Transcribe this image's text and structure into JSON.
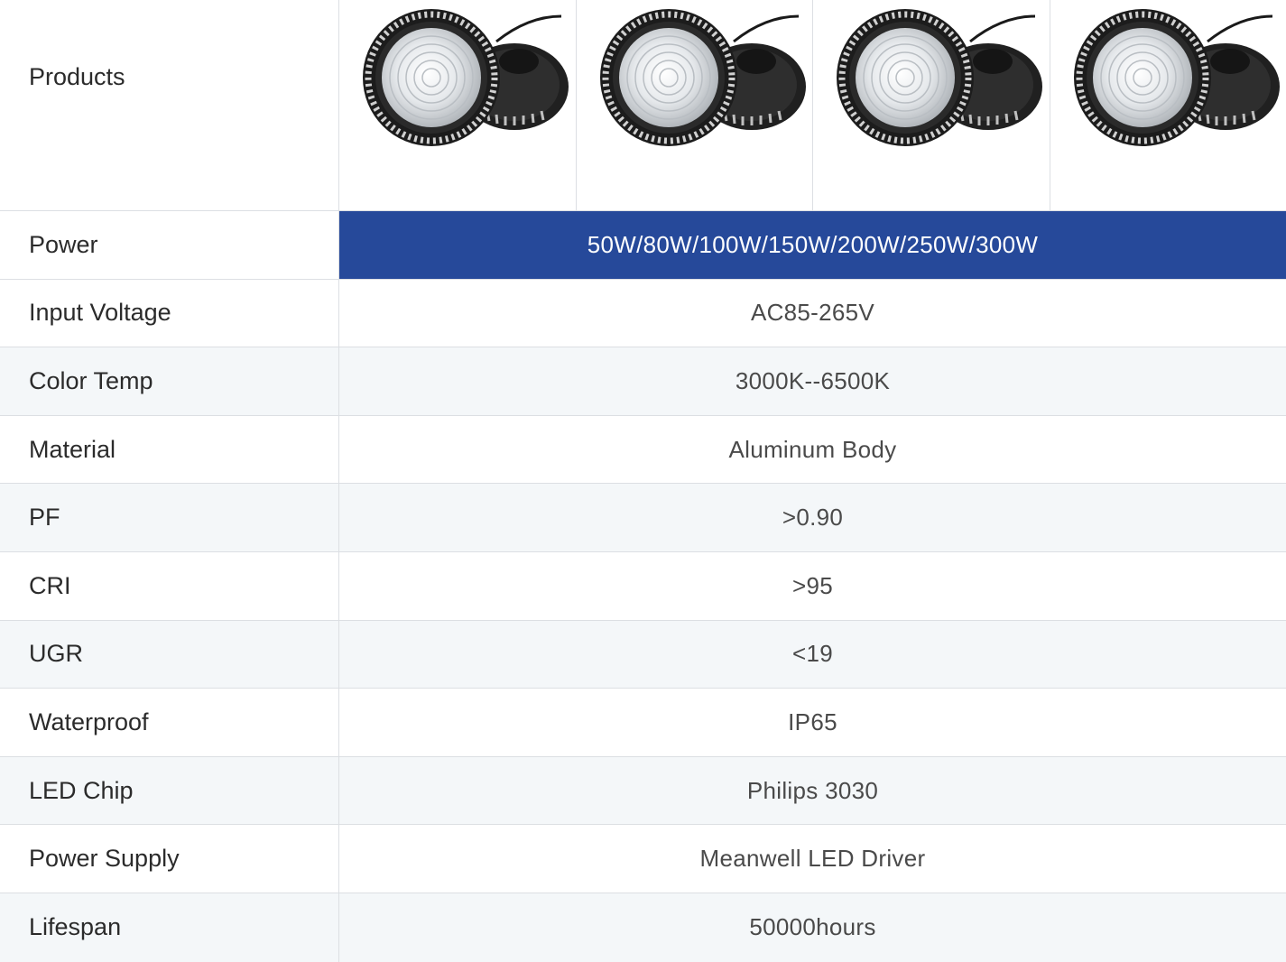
{
  "products": {
    "label": "Products",
    "items": [
      {
        "image": "led-high-bay-light-image"
      },
      {
        "image": "led-high-bay-light-image"
      },
      {
        "image": "led-high-bay-light-image"
      },
      {
        "image": "led-high-bay-light-image"
      }
    ]
  },
  "specs": [
    {
      "label": "Power",
      "value": "50W/80W/100W/150W/200W/250W/300W"
    },
    {
      "label": "Input Voltage",
      "value": "AC85-265V"
    },
    {
      "label": "Color Temp",
      "value": "3000K--6500K"
    },
    {
      "label": "Material",
      "value": "Aluminum Body"
    },
    {
      "label": "PF",
      "value": ">0.90"
    },
    {
      "label": "CRI",
      "value": ">95"
    },
    {
      "label": "UGR",
      "value": "<19"
    },
    {
      "label": "Waterproof",
      "value": "IP65"
    },
    {
      "label": "LED Chip",
      "value": "Philips 3030"
    },
    {
      "label": "Power Supply",
      "value": "Meanwell LED Driver"
    },
    {
      "label": "Lifespan",
      "value": "50000hours"
    }
  ],
  "colors": {
    "highlight": "#26499a",
    "alt_row": "#f4f7f9",
    "border": "#dcdfe3"
  }
}
